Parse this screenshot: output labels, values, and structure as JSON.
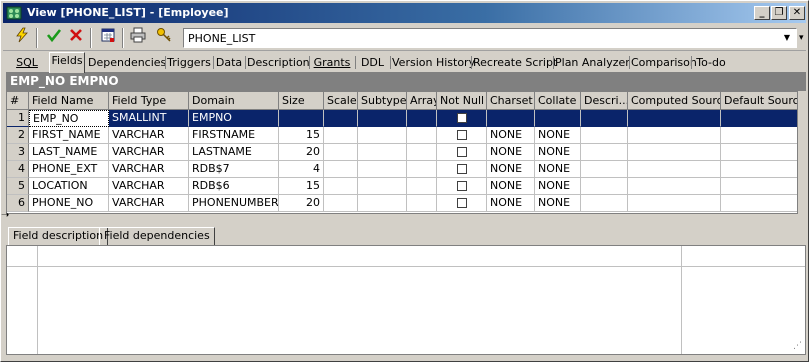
{
  "window": {
    "title": "View [PHONE_LIST] - [Employee]",
    "controls": {
      "minimize": "_",
      "restore": "❐",
      "close": "✕"
    }
  },
  "toolbar": {
    "object_selector_value": "PHONE_LIST",
    "icons": [
      "lightning-icon",
      "check-icon",
      "cross-icon",
      "calendar-icon",
      "print-icon",
      "keys-icon"
    ]
  },
  "tabs": [
    "SQL",
    "Fields",
    "Dependencies",
    "Triggers",
    "Data",
    "Description",
    "Grants",
    "DDL",
    "Version History",
    "Recreate Script",
    "Plan Analyzer",
    "Comparison",
    "To-do"
  ],
  "active_tab": "Fields",
  "caption": "EMP_NO EMPNO",
  "grid": {
    "headers": [
      "#",
      "Field Name",
      "Field Type",
      "Domain",
      "Size",
      "Scale",
      "Subtype",
      "Array",
      "Not Null",
      "Charset",
      "Collate",
      "Descri...",
      "Computed Source",
      "Default Source"
    ],
    "rows": [
      {
        "no": "1",
        "field_name": "EMP_NO",
        "field_type": "SMALLINT",
        "domain": "EMPNO",
        "size": "",
        "charset": "",
        "collate": ""
      },
      {
        "no": "2",
        "field_name": "FIRST_NAME",
        "field_type": "VARCHAR",
        "domain": "FIRSTNAME",
        "size": "15",
        "charset": "NONE",
        "collate": "NONE"
      },
      {
        "no": "3",
        "field_name": "LAST_NAME",
        "field_type": "VARCHAR",
        "domain": "LASTNAME",
        "size": "20",
        "charset": "NONE",
        "collate": "NONE"
      },
      {
        "no": "4",
        "field_name": "PHONE_EXT",
        "field_type": "VARCHAR",
        "domain": "RDB$7",
        "size": "4",
        "charset": "NONE",
        "collate": "NONE"
      },
      {
        "no": "5",
        "field_name": "LOCATION",
        "field_type": "VARCHAR",
        "domain": "RDB$6",
        "size": "15",
        "charset": "NONE",
        "collate": "NONE"
      },
      {
        "no": "6",
        "field_name": "PHONE_NO",
        "field_type": "VARCHAR",
        "domain": "PHONENUMBER",
        "size": "20",
        "charset": "NONE",
        "collate": "NONE"
      }
    ],
    "selected_row": 0
  },
  "bottom_tabs": [
    "Field description",
    "Field dependencies"
  ],
  "colors": {
    "title_start": "#0a246a",
    "title_end": "#a6caf0",
    "selection": "#0a246a",
    "caption": "#808080",
    "face": "#d4d0c8"
  }
}
